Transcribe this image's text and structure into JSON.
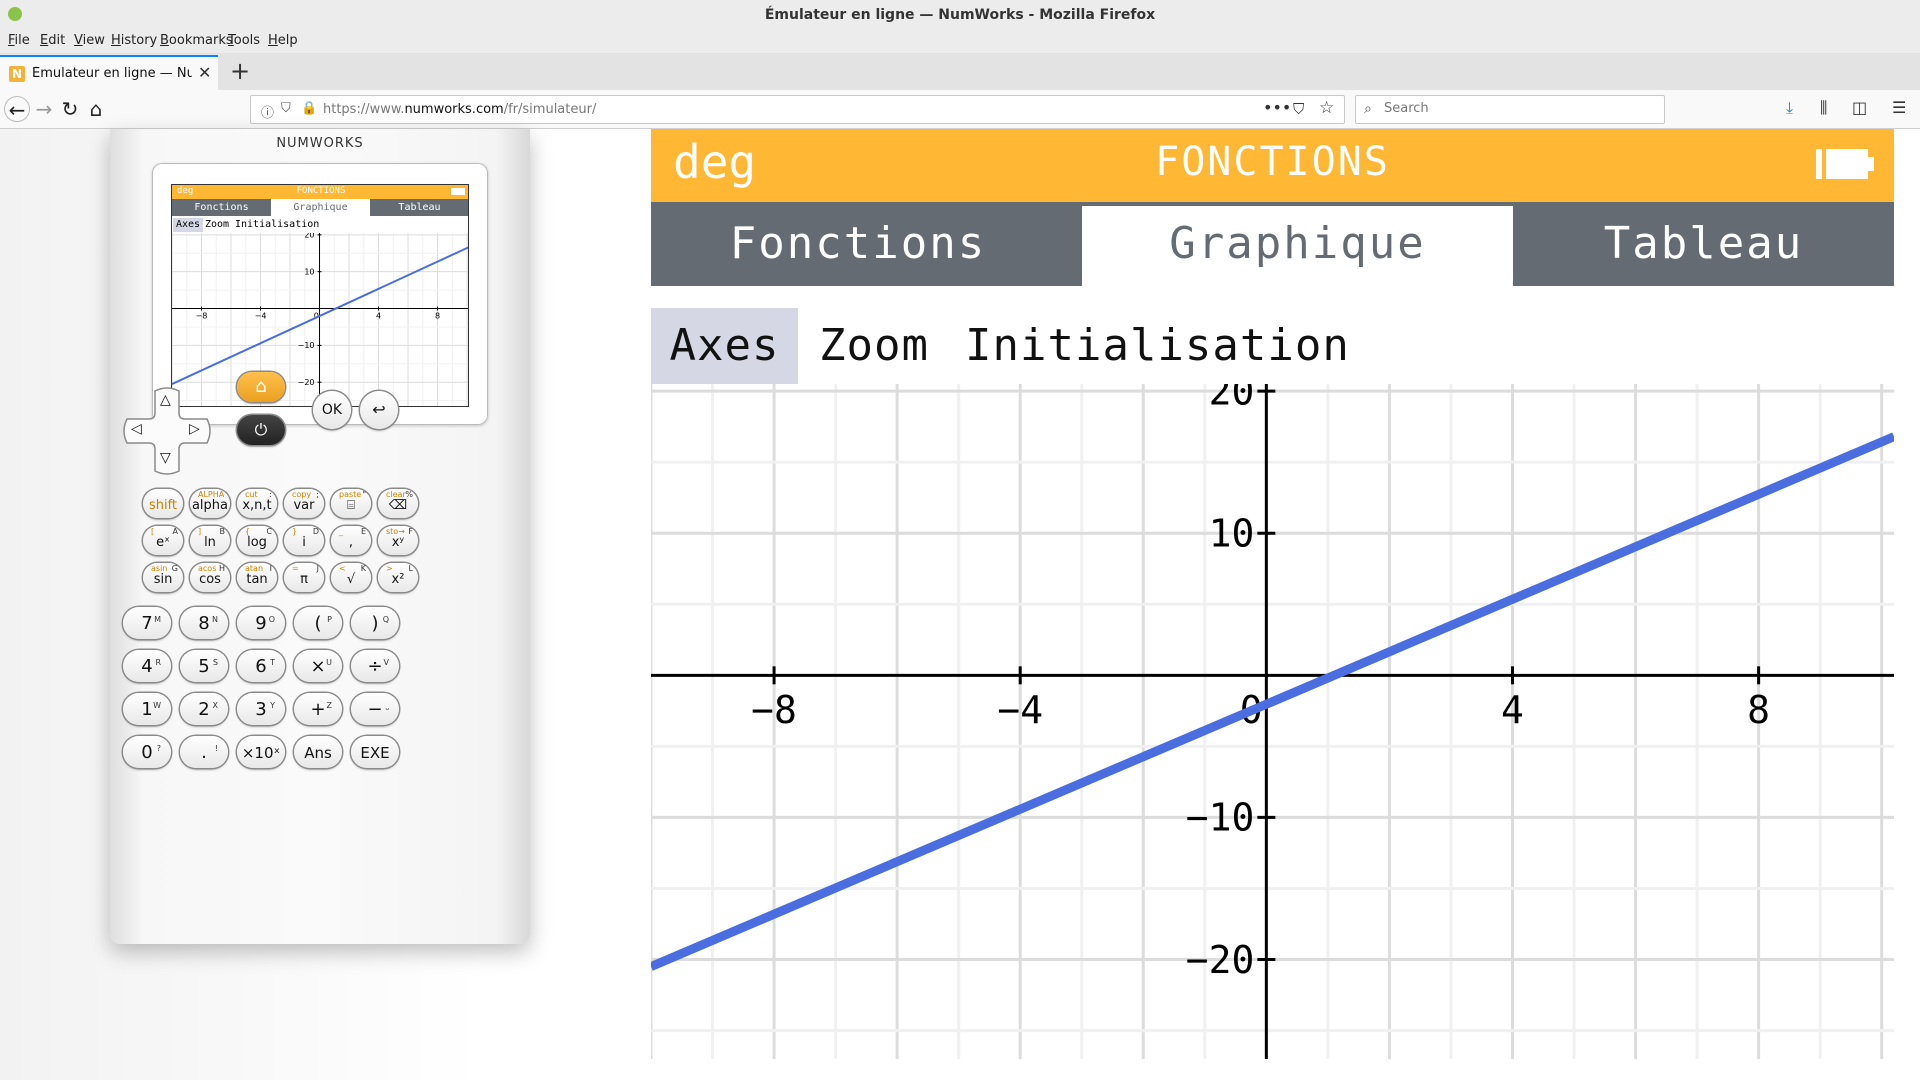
{
  "browser": {
    "window_title": "Émulateur en ligne — NumWorks - Mozilla Firefox",
    "menu": [
      {
        "label": "File",
        "key": "F",
        "rest": "ile"
      },
      {
        "label": "Edit",
        "key": "E",
        "rest": "dit"
      },
      {
        "label": "View",
        "key": "V",
        "rest": "iew"
      },
      {
        "label": "History",
        "key": "H",
        "rest": "istory"
      },
      {
        "label": "Bookmarks",
        "key": "B",
        "rest": "ookmarks"
      },
      {
        "label": "Tools",
        "key": "T",
        "rest": "ools"
      },
      {
        "label": "Help",
        "key": "H",
        "rest": "elp"
      }
    ],
    "tab_title": "Émulateur en ligne — NumWorks",
    "tab_favicon": "N",
    "url_prefix": "https://www.",
    "url_domain": "numworks.com",
    "url_path": "/fr/simulateur/",
    "search_placeholder": "Search",
    "icons": {
      "back": "←",
      "forward": "→",
      "reload": "↻",
      "home": "⌂",
      "info": "ⓘ",
      "shield": "⛉",
      "lock": "🔒",
      "page_actions": "•••",
      "pocket": "⛉",
      "star": "☆",
      "search": "⌕",
      "downloads": "⤓",
      "library": "⫼",
      "sidebar": "◫",
      "menu": "☰",
      "close": "✕",
      "new_tab": "+"
    }
  },
  "calculator": {
    "brand": "NUMWORKS",
    "mini_screen": {
      "angle": "deg",
      "title": "FONCTIONS",
      "tabs": [
        "Fonctions",
        "Graphique",
        "Tableau"
      ],
      "selected_tab": 1,
      "menu": [
        "Axes",
        "Zoom",
        "Initialisation"
      ],
      "selected_menu": 0,
      "x_ticks": [
        "-8",
        "-4",
        "0",
        "4",
        "8"
      ],
      "y_ticks": [
        "20",
        "10",
        "-10",
        "-20"
      ]
    },
    "nav_keys": {
      "up": "△",
      "left": "◁",
      "right": "▷",
      "down": "▽",
      "home": "⌂",
      "power": "⏻",
      "ok": "OK",
      "back": "↩"
    },
    "function_keys": [
      [
        {
          "main": "shift",
          "sub": "",
          "sup": ""
        },
        {
          "main": "alpha",
          "sub": "ALPHA",
          "sup": ""
        },
        {
          "main": "x,n,t",
          "sub": "cut",
          "sup": ":"
        },
        {
          "main": "var",
          "sub": "copy",
          "sup": ";"
        },
        {
          "main": "⌸",
          "sub": "paste",
          "sup": "\""
        },
        {
          "main": "⌫",
          "sub": "clear",
          "sup": "%"
        }
      ],
      [
        {
          "main": "eˣ",
          "sub": "[",
          "sup": "A"
        },
        {
          "main": "ln",
          "sub": "]",
          "sup": "B"
        },
        {
          "main": "log",
          "sub": "{",
          "sup": "C"
        },
        {
          "main": "i",
          "sub": "}",
          "sup": "D"
        },
        {
          "main": ",",
          "sub": "_",
          "sup": "E"
        },
        {
          "main": "xʸ",
          "sub": "sto→",
          "sup": "F"
        }
      ],
      [
        {
          "main": "sin",
          "sub": "asin",
          "sup": "G"
        },
        {
          "main": "cos",
          "sub": "acos",
          "sup": "H"
        },
        {
          "main": "tan",
          "sub": "atan",
          "sup": "I"
        },
        {
          "main": "π",
          "sub": "=",
          "sup": "J"
        },
        {
          "main": "√",
          "sub": "<",
          "sup": "K"
        },
        {
          "main": "x²",
          "sub": ">",
          "sup": "L"
        }
      ]
    ],
    "number_keys": [
      [
        {
          "main": "7",
          "sup": "M"
        },
        {
          "main": "8",
          "sup": "N"
        },
        {
          "main": "9",
          "sup": "O"
        },
        {
          "main": "(",
          "sup": "P"
        },
        {
          "main": ")",
          "sup": "Q"
        }
      ],
      [
        {
          "main": "4",
          "sup": "R"
        },
        {
          "main": "5",
          "sup": "S"
        },
        {
          "main": "6",
          "sup": "T"
        },
        {
          "main": "×",
          "sup": "U"
        },
        {
          "main": "÷",
          "sup": "V"
        }
      ],
      [
        {
          "main": "1",
          "sup": "W"
        },
        {
          "main": "2",
          "sup": "X"
        },
        {
          "main": "3",
          "sup": "Y"
        },
        {
          "main": "+",
          "sup": "Z"
        },
        {
          "main": "−",
          "sup": "⎵"
        }
      ],
      [
        {
          "main": "0",
          "sup": "?"
        },
        {
          "main": ".",
          "sup": "!"
        },
        {
          "main": "×10ˣ",
          "sup": ""
        },
        {
          "main": "Ans",
          "sup": ""
        },
        {
          "main": "EXE",
          "sup": ""
        }
      ]
    ]
  },
  "emulator_screen": {
    "angle": "deg",
    "title": "FONCTIONS",
    "tabs": [
      "Fonctions",
      "Graphique",
      "Tableau"
    ],
    "selected_tab": 1,
    "menu": [
      "Axes",
      "Zoom",
      "Initialisation"
    ],
    "selected_menu": 0,
    "colors": {
      "header": "#ffb734",
      "tabs": "#646b73",
      "selected_menu": "#d5d7e5",
      "curve": "#4a6ee0",
      "grid": "#e6e6e6"
    }
  },
  "chart_data": {
    "type": "line",
    "x_ticks": [
      "-8",
      "-4",
      "0",
      "4",
      "8"
    ],
    "y_ticks": [
      "20",
      "10",
      "-10",
      "-20"
    ],
    "xlim": [
      -10,
      10.2
    ],
    "ylim": [
      -27,
      20.5
    ],
    "grid": true,
    "series": [
      {
        "x": [
          -10,
          10.2
        ],
        "y": [
          -20.5,
          16.8
        ]
      }
    ]
  }
}
